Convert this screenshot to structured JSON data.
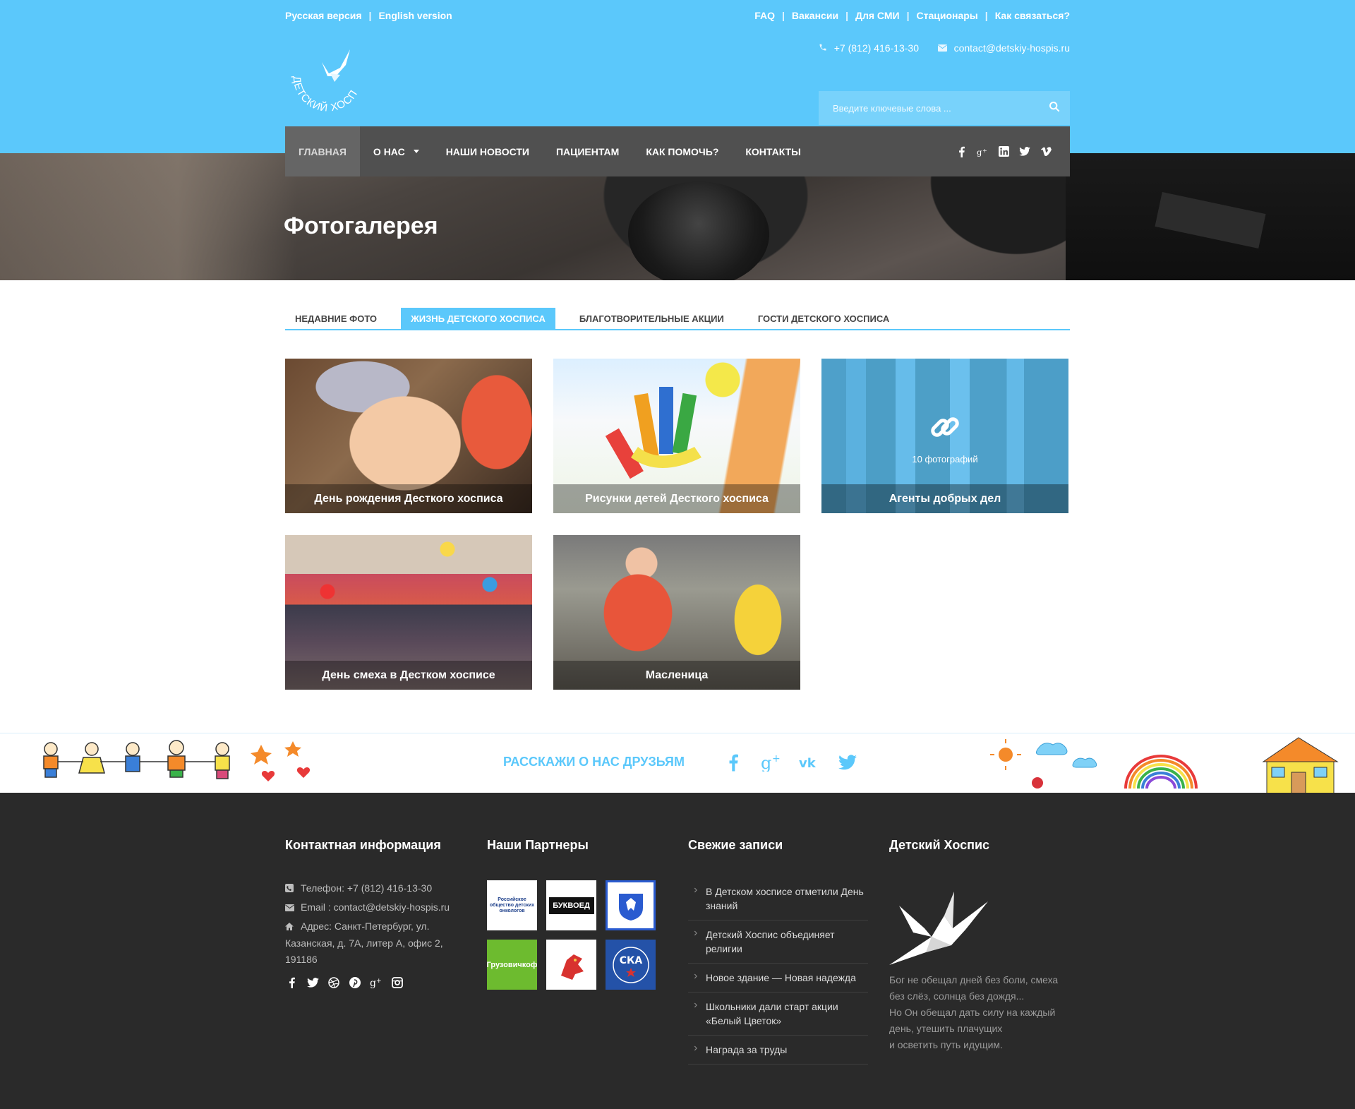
{
  "header": {
    "lang_ru": "Русская версия",
    "lang_en": "English version",
    "top_links": [
      "FAQ",
      "Вакансии",
      "Для СМИ",
      "Стационары",
      "Как связаться?"
    ],
    "phone": "+7 (812) 416-13-30",
    "email": "contact@detskiy-hospis.ru",
    "logo_text": "ДЕТСКИЙ ХОСПИС",
    "search_placeholder": "Введите ключевые слова ...",
    "accent": "#5bc8fb"
  },
  "nav": {
    "items": [
      "ГЛАВНАЯ",
      "О НАС",
      "НАШИ НОВОСТИ",
      "ПАЦИЕНТАМ",
      "КАК ПОМОЧЬ?",
      "КОНТАКТЫ"
    ],
    "active": "ГЛАВНАЯ",
    "social_icons": [
      "facebook-icon",
      "google-plus-icon",
      "linkedin-icon",
      "twitter-icon",
      "vimeo-icon"
    ]
  },
  "banner": {
    "title": "Фотогалерея"
  },
  "tabs": {
    "items": [
      "НЕДАВНИЕ ФОТО",
      "ЖИЗНЬ ДЕТСКОГО ХОСПИСА",
      "БЛАГОТВОРИТЕЛЬНЫЕ АКЦИИ",
      "ГОСТИ ДЕТСКОГО ХОСПИСА"
    ],
    "active": "ЖИЗНЬ ДЕТСКОГО ХОСПИСА"
  },
  "gallery": [
    {
      "title": "День рождения Десткого хосписа"
    },
    {
      "title": "Рисунки детей Десткого хосписа"
    },
    {
      "title": "Агенты добрых дел",
      "count": "10 фотографий"
    },
    {
      "title": "День смеха в Дестком хосписе"
    },
    {
      "title": "Масленица"
    }
  ],
  "share": {
    "label": "РАССКАЖИ О НАС ДРУЗЬЯМ",
    "icons": [
      "facebook-icon",
      "google-plus-icon",
      "vk-icon",
      "twitter-icon"
    ]
  },
  "footer": {
    "contact": {
      "heading": "Контактная информация",
      "phone": "Телефон: +7 (812) 416-13-30",
      "email": "Email : contact@detskiy-hospis.ru",
      "address": "Адрес: Санкт-Петербург, ул. Казанская, д. 7А, литер А, офис 2, 191186",
      "social_icons": [
        "facebook-icon",
        "twitter-icon",
        "dribbble-icon",
        "pinterest-icon",
        "google-plus-icon",
        "instagram-icon"
      ]
    },
    "partners": {
      "heading": "Наши Партнеры",
      "items": [
        "Российское общество детских онкологов",
        "Буквоед",
        "Герб России",
        "Грузовичкоф",
        "Грифон",
        "СКА 1946"
      ],
      "labels": [
        "Российское общество детских онкологов",
        "БУКВОЕД",
        "",
        "Грузовичкоф",
        "",
        "СКА"
      ]
    },
    "posts": {
      "heading": "Свежие записи",
      "items": [
        "В Детском хосписе отметили День знаний",
        "Детский Хоспис объединяет религии",
        "Новое здание — Новая надежда",
        "Школьники дали старт акции «Белый Цветок»",
        "Награда за труды"
      ]
    },
    "about": {
      "heading": "Детский Хоспис",
      "quote": [
        "Бог не обещал дней без боли, смеха",
        "без слёз, солнца без дождя...",
        "Но Он обещал дать силу на каждый",
        "день, утешить плачущих",
        "и осветить путь идущим."
      ]
    }
  }
}
